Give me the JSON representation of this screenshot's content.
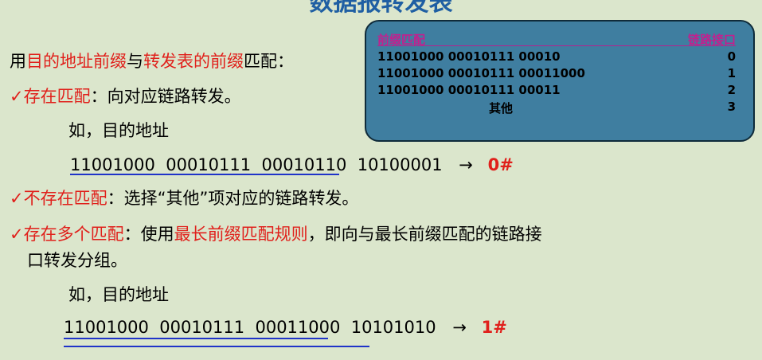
{
  "title": "数据报转发表",
  "intro": {
    "prefix_text": "用",
    "red1": "目的地址前缀",
    "mid": "与",
    "red2": "转发表的前缀",
    "suffix": "匹配："
  },
  "case1": {
    "check": "✓",
    "label": "存在匹配",
    "text": "：向对应链路转发。"
  },
  "example1": {
    "label": "如，目的地址",
    "address_part1": "11001000  00010111  00010",
    "address_part2": "110  10100001",
    "arrow": "→",
    "result": "0#"
  },
  "case2": {
    "check": "✓",
    "label": "不存在匹配",
    "text": "：选择“其他”项对应的链路转发。"
  },
  "case3": {
    "check": "✓",
    "label": "存在多个匹配",
    "text1": "：使用",
    "rule": "最长前缀匹配规则",
    "text2": "，即向与最长前缀匹配的链路接",
    "text3": "口转发分组。"
  },
  "example2": {
    "label": "如，目的地址",
    "address_part1": "11001000  00010111  00011000",
    "address_part2": "  10101010",
    "arrow": "→",
    "result": "1#"
  },
  "table": {
    "header_prefix": "前缀匹配",
    "header_iface": "链路接口",
    "rows": [
      {
        "prefix": "11001000 00010111 00010",
        "iface": "0"
      },
      {
        "prefix": "11001000 00010111 00011000",
        "iface": "1"
      },
      {
        "prefix": "11001000 00010111 00011",
        "iface": "2"
      },
      {
        "prefix": "其他",
        "iface": "3"
      }
    ]
  },
  "colors": {
    "background": "#dbe6cc",
    "red": "#e0201b",
    "title_blue": "#1f5fa3",
    "table_bg": "#3f7ea0",
    "table_header": "#c41f8e",
    "underline_blue": "#1f33c9"
  }
}
